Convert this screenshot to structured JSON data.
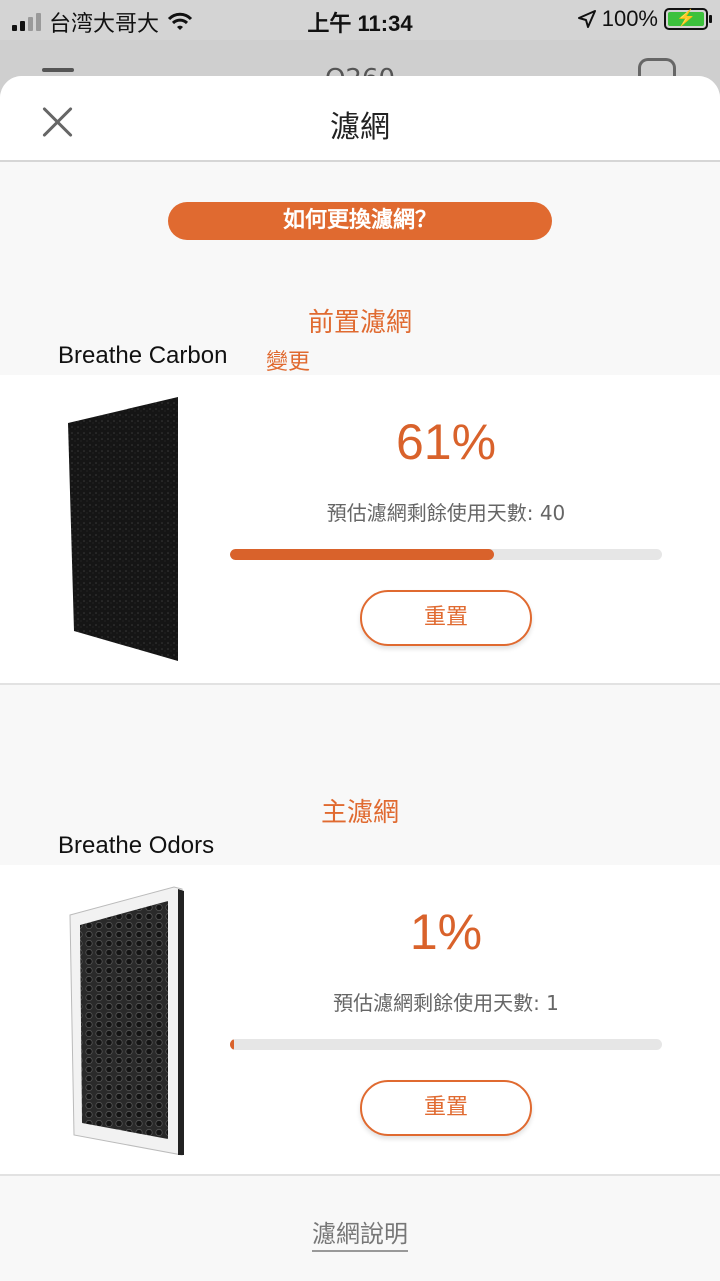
{
  "status_bar": {
    "carrier": "台湾大哥大",
    "time": "上午 11:34",
    "battery": "100%"
  },
  "background_screen": {
    "title": "Q260"
  },
  "sheet": {
    "title": "濾網",
    "how_to_replace": "如何更換濾網？",
    "manual_link": "濾網說明"
  },
  "pre_filter": {
    "heading": "前置濾網",
    "name": "Breathe Carbon",
    "change_label": "變更",
    "percent": "61%",
    "remaining": "預估濾網剩餘使用天數: 40",
    "progress": 0.61,
    "reset_label": "重置"
  },
  "main_filter": {
    "heading": "主濾網",
    "name": "Breathe Odors",
    "percent": "1%",
    "remaining": "預估濾網剩餘使用天數: 1",
    "progress": 0.01,
    "reset_label": "重置"
  },
  "colors": {
    "accent": "#e06a30",
    "track": "#e6e6e6"
  }
}
